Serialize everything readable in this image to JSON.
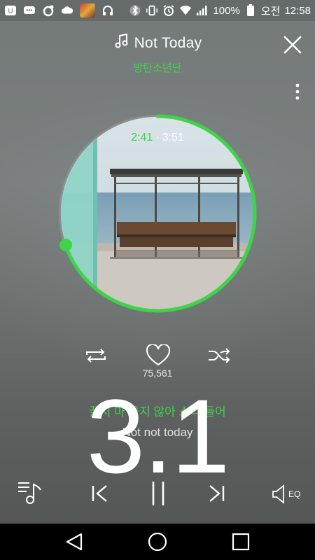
{
  "status_bar": {
    "battery": "100%",
    "ampm": "오전",
    "time": "12:58",
    "icons": [
      "messenger-icon",
      "chat-icon",
      "app-icon",
      "cloud-icon",
      "app-thumbnail",
      "headphones-icon",
      "bluetooth-icon",
      "vibrate-icon",
      "alarm-icon",
      "wifi-icon",
      "signal-icon",
      "battery-icon"
    ]
  },
  "player": {
    "title": "Not Today",
    "artist": "방탄소년단",
    "current_time": "2:41",
    "total_time": "3:51",
    "progress": 0.697,
    "like_count": "75,561",
    "eq_label": "EQ"
  },
  "lyrics": {
    "current": "꿇지 마 울지 않아 소리 들어",
    "next": "Not not today"
  },
  "overlay": {
    "number": "3.1"
  },
  "colors": {
    "accent": "#3fd34a",
    "background": "#747a79"
  }
}
